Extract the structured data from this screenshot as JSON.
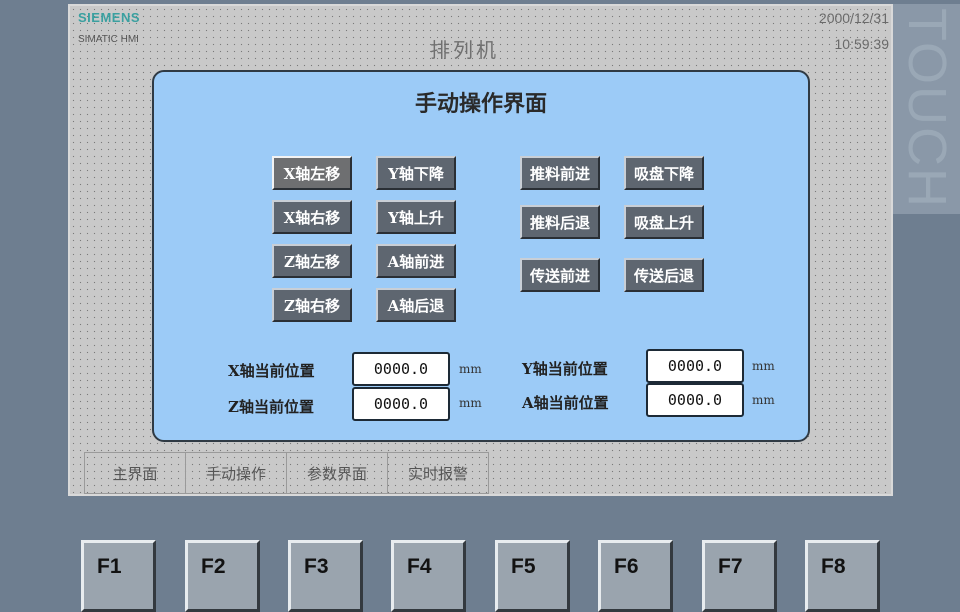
{
  "device": {
    "brand": "SIEMENS",
    "model": "SIMATIC HMI",
    "side_label": "TOUCH"
  },
  "header": {
    "title": "排列机",
    "date": "2000/12/31",
    "time": "10:59:39"
  },
  "panel": {
    "title": "手动操作界面",
    "axis_buttons": [
      {
        "label": "X轴左移"
      },
      {
        "label": "Y轴下降"
      },
      {
        "label": "X轴右移"
      },
      {
        "label": "Y轴上升"
      },
      {
        "label": "Z轴左移"
      },
      {
        "label": "A轴前进"
      },
      {
        "label": "Z轴右移"
      },
      {
        "label": "A轴后退"
      }
    ],
    "process_buttons": [
      {
        "label": "推料前进"
      },
      {
        "label": "吸盘下降"
      },
      {
        "label": "推料后退"
      },
      {
        "label": "吸盘上升"
      },
      {
        "label": "传送前进"
      },
      {
        "label": "传送后退"
      }
    ],
    "positions": [
      {
        "label": "X轴当前位置",
        "value": "0000.0",
        "unit": "mm"
      },
      {
        "label": "Z轴当前位置",
        "value": "0000.0",
        "unit": "mm"
      },
      {
        "label": "Y轴当前位置",
        "value": "0000.0",
        "unit": "mm"
      },
      {
        "label": "A轴当前位置",
        "value": "0000.0",
        "unit": "mm"
      }
    ]
  },
  "tabs": [
    {
      "label": "主界面"
    },
    {
      "label": "手动操作"
    },
    {
      "label": "参数界面"
    },
    {
      "label": "实时报警"
    }
  ],
  "function_keys": [
    "F1",
    "F2",
    "F3",
    "F4",
    "F5",
    "F6",
    "F7",
    "F8"
  ]
}
